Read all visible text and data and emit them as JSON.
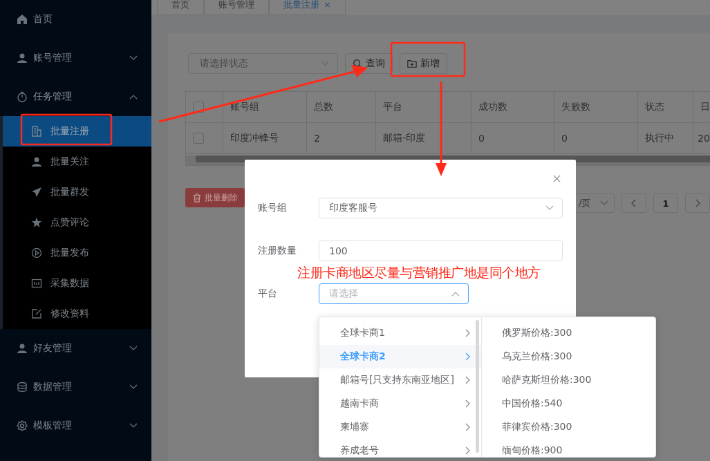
{
  "sidebar": {
    "items": [
      {
        "label": "首页",
        "kind": "link",
        "expanded": false
      },
      {
        "label": "账号管理",
        "kind": "submenu",
        "expanded": false
      },
      {
        "label": "任务管理",
        "kind": "submenu",
        "expanded": true,
        "children": [
          {
            "label": "批量注册",
            "selected": true
          },
          {
            "label": "批量关注",
            "selected": false
          },
          {
            "label": "批量群发",
            "selected": false
          },
          {
            "label": "点赞评论",
            "selected": false
          },
          {
            "label": "批量发布",
            "selected": false
          },
          {
            "label": "采集数据",
            "selected": false
          },
          {
            "label": "修改资料",
            "selected": false
          }
        ]
      },
      {
        "label": "好友管理",
        "kind": "submenu",
        "expanded": false
      },
      {
        "label": "数据管理",
        "kind": "submenu",
        "expanded": false
      },
      {
        "label": "模板管理",
        "kind": "submenu",
        "expanded": false
      }
    ]
  },
  "tabs": [
    {
      "label": "首页",
      "selected": false
    },
    {
      "label": "账号管理",
      "selected": false
    },
    {
      "label": "批量注册",
      "selected": true,
      "close": "×"
    }
  ],
  "filter": {
    "status_placeholder": "请选择状态",
    "buttons": [
      "查询",
      "新增"
    ]
  },
  "table": {
    "header_checked": false,
    "columns": [
      "账号组",
      "总数",
      "平台",
      "成功数",
      "失败数",
      "状态",
      "日"
    ],
    "rows": [
      {
        "checked": false,
        "cells": [
          "印度冲锋号",
          "2",
          "邮箱-印度",
          "0",
          "0",
          "执行中",
          "20"
        ]
      }
    ]
  },
  "batch_delete": "批量删除",
  "pagination": {
    "page_size": "/页",
    "pages": [
      {
        "label": "1",
        "selected": true
      }
    ]
  },
  "dialog": {
    "fields": [
      {
        "label": "账号组",
        "kind": "select",
        "value": "印度客服号",
        "open": false
      },
      {
        "label": "注册数量",
        "kind": "input",
        "value": "100"
      },
      {
        "label": "平台",
        "kind": "select",
        "placeholder": "请选择",
        "open": true
      }
    ],
    "note": "注册卡商地区尽量与营销推广地是同个地方"
  },
  "cascader": {
    "column_1": [
      {
        "label": "全球卡商1",
        "selected": false
      },
      {
        "label": "全球卡商2",
        "selected": true
      },
      {
        "label": "邮箱号[只支持东南亚地区]",
        "selected": false
      },
      {
        "label": "越南卡商",
        "selected": false
      },
      {
        "label": "柬埔寨",
        "selected": false
      },
      {
        "label": "养成老号",
        "selected": false
      }
    ],
    "column_2": [
      "俄罗斯价格:300",
      "乌克兰价格:300",
      "哈萨克斯坦价格:300",
      "中国价格:540",
      "菲律宾价格:300",
      "缅甸价格:900"
    ]
  }
}
